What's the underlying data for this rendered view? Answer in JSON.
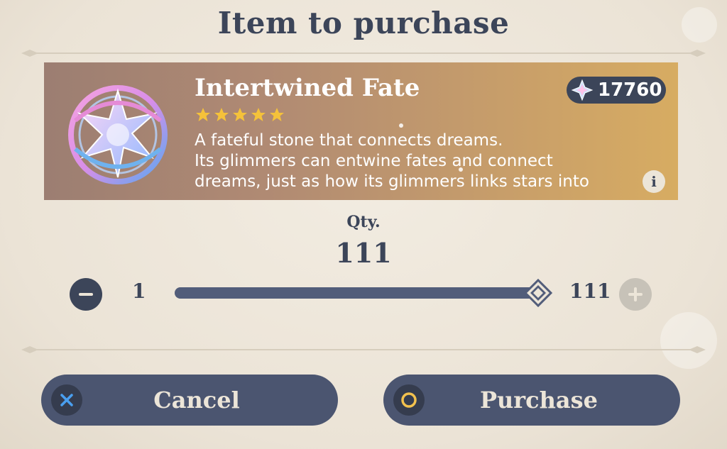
{
  "dialog": {
    "title": "Item to purchase"
  },
  "item": {
    "name": "Intertwined Fate",
    "rarity_stars": 5,
    "icon": "intertwined-fate-icon",
    "description_lines": [
      "A fateful stone that connects dreams.",
      "Its glimmers can entwine fates and connect",
      "dreams, just as how its glimmers links stars into"
    ]
  },
  "currency": {
    "icon": "primogem-icon",
    "amount": "17760"
  },
  "quantity": {
    "label": "Qty.",
    "value": "111",
    "min": "1",
    "max": "111",
    "slider_fraction": 1.0
  },
  "actions": {
    "cancel_label": "Cancel",
    "cancel_icon": "x-icon",
    "purchase_label": "Purchase",
    "purchase_icon": "circle-icon"
  },
  "colors": {
    "primary_dark": "#3c4559",
    "button_bg": "#4b5570",
    "background": "#ece5d8",
    "star_gold": "#f5c23a",
    "cancel_icon": "#4a9ff0",
    "purchase_icon": "#f2c14e"
  }
}
